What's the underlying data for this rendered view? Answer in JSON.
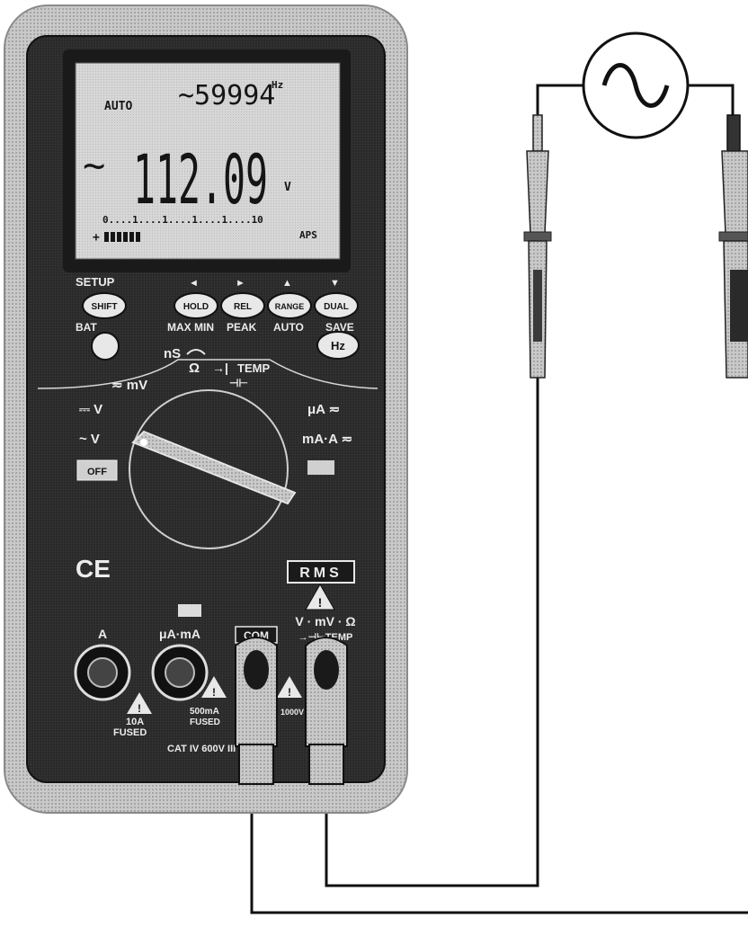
{
  "display": {
    "auto": "AUTO",
    "freq_reading": "~59994",
    "freq_unit": "Hz",
    "main_ac_symbol": "~",
    "main_reading": "112.09",
    "main_unit": "V",
    "bargraph_scale": "0....1....1....1....1....10",
    "aps": "APS"
  },
  "buttons": {
    "setup": "SETUP",
    "shift": "SHIFT",
    "hold": "HOLD",
    "rel": "REL",
    "range": "RANGE",
    "dual": "DUAL",
    "bat": "BAT",
    "max_min": "MAX MIN",
    "peak": "PEAK",
    "auto": "AUTO",
    "save": "SAVE",
    "hz": "Hz",
    "arrow_left": "◄",
    "arrow_right": "►",
    "arrow_up": "▲",
    "arrow_down": "▼"
  },
  "dial": {
    "ns": "nS",
    "ohm": "Ω",
    "diode": "→|",
    "temp": "TEMP",
    "cap": "⊣⊢",
    "mv": "≂ mV",
    "v_dc": "⎓ V",
    "v_ac": "~ V",
    "ua": "μA ≂",
    "ma_a": "mA·A ≂",
    "off": "OFF"
  },
  "labels": {
    "ce": "CE",
    "rms": "RMS",
    "terminal_a": "A",
    "terminal_ua_ma": "μA·mA",
    "terminal_com": "COM",
    "terminal_v": "V · mV · Ω",
    "terminal_v2": "→⊣⊢TEMP",
    "fuse_10a_1": "10A",
    "fuse_10a_2": "FUSED",
    "fuse_ma_1": "500mA",
    "fuse_ma_2": "FUSED",
    "v1000": "1000V",
    "cat": "CAT  IV 600V  III 1000V",
    "warn": "!"
  },
  "source": {
    "symbol": "~"
  }
}
